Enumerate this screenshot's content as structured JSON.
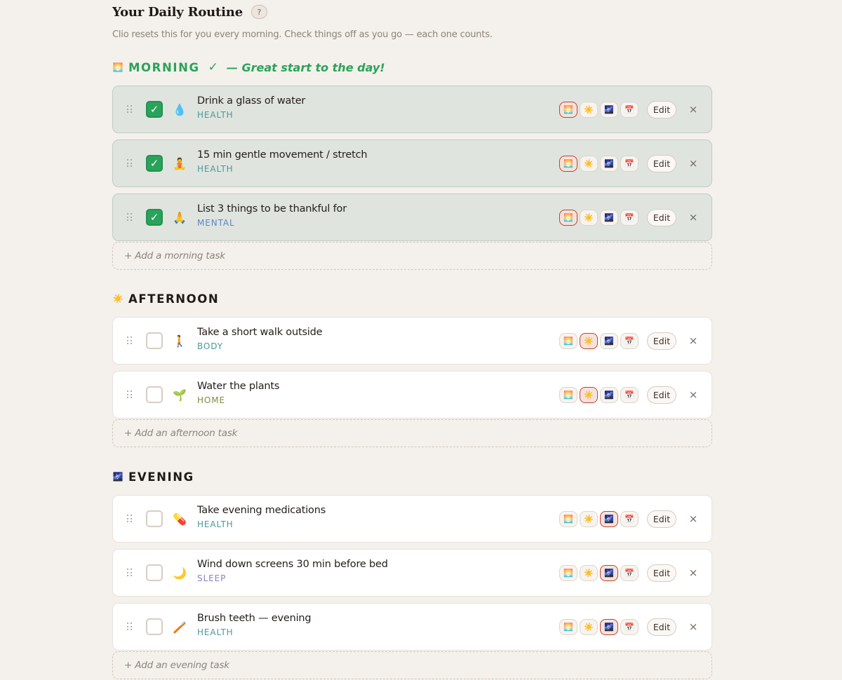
{
  "header": {
    "title": "Your Daily Routine",
    "help_label": "?",
    "subtitle": "Clio resets this for you every morning. Check things off as you go — each one counts."
  },
  "colors": {
    "done_green": "#2aa35a",
    "morning_heading": "#2aa35a",
    "heading_dark": "#1f1a17",
    "tag_health": "#4b9a99",
    "tag_mental": "#5a86c4",
    "tag_body": "#4b9a99",
    "tag_home": "#7c8c3e",
    "tag_sleep": "#8c7fc0",
    "active_slot_border": "#c2412c"
  },
  "slot_icons": [
    "🌅",
    "☀️",
    "🌌",
    "📅"
  ],
  "sections": [
    {
      "key": "morning",
      "emoji": "🌅",
      "title": "MORNING",
      "check": "✓",
      "note": "— Great start to the day!",
      "add_label": "+ Add a morning task",
      "tasks": [
        {
          "icon": "💧",
          "icon_name": "water-drop-icon",
          "title": "Drink a glass of water",
          "tag": "HEALTH",
          "tag_color": "#4b9a99",
          "done": true,
          "active_slot": 0
        },
        {
          "icon": "🧘",
          "icon_name": "meditation-icon",
          "title": "15 min gentle movement / stretch",
          "tag": "HEALTH",
          "tag_color": "#4b9a99",
          "done": true,
          "active_slot": 0
        },
        {
          "icon": "🙏",
          "icon_name": "praying-hands-icon",
          "title": "List 3 things to be thankful for",
          "tag": "MENTAL",
          "tag_color": "#5a86c4",
          "done": true,
          "active_slot": 0
        }
      ]
    },
    {
      "key": "afternoon",
      "emoji": "☀️",
      "title": "AFTERNOON",
      "check": "",
      "note": "",
      "add_label": "+ Add an afternoon task",
      "tasks": [
        {
          "icon": "🚶",
          "icon_name": "walking-person-icon",
          "title": "Take a short walk outside",
          "tag": "BODY",
          "tag_color": "#4b9a99",
          "done": false,
          "active_slot": 1
        },
        {
          "icon": "🌱",
          "icon_name": "seedling-icon",
          "title": "Water the plants",
          "tag": "HOME",
          "tag_color": "#7c8c3e",
          "done": false,
          "active_slot": 1
        }
      ]
    },
    {
      "key": "evening",
      "emoji": "🌌",
      "title": "EVENING",
      "check": "",
      "note": "",
      "add_label": "+ Add an evening task",
      "tasks": [
        {
          "icon": "💊",
          "icon_name": "pill-icon",
          "title": "Take evening medications",
          "tag": "HEALTH",
          "tag_color": "#4b9a99",
          "done": false,
          "active_slot": 2
        },
        {
          "icon": "🌙",
          "icon_name": "moon-icon",
          "title": "Wind down screens 30 min before bed",
          "tag": "SLEEP",
          "tag_color": "#8c7fc0",
          "done": false,
          "active_slot": 2
        },
        {
          "icon": "🪥",
          "icon_name": "toothbrush-icon",
          "title": "Brush teeth — evening",
          "tag": "HEALTH",
          "tag_color": "#4b9a99",
          "done": false,
          "active_slot": 2
        }
      ]
    }
  ],
  "edit_label": "Edit",
  "close_label": "×"
}
